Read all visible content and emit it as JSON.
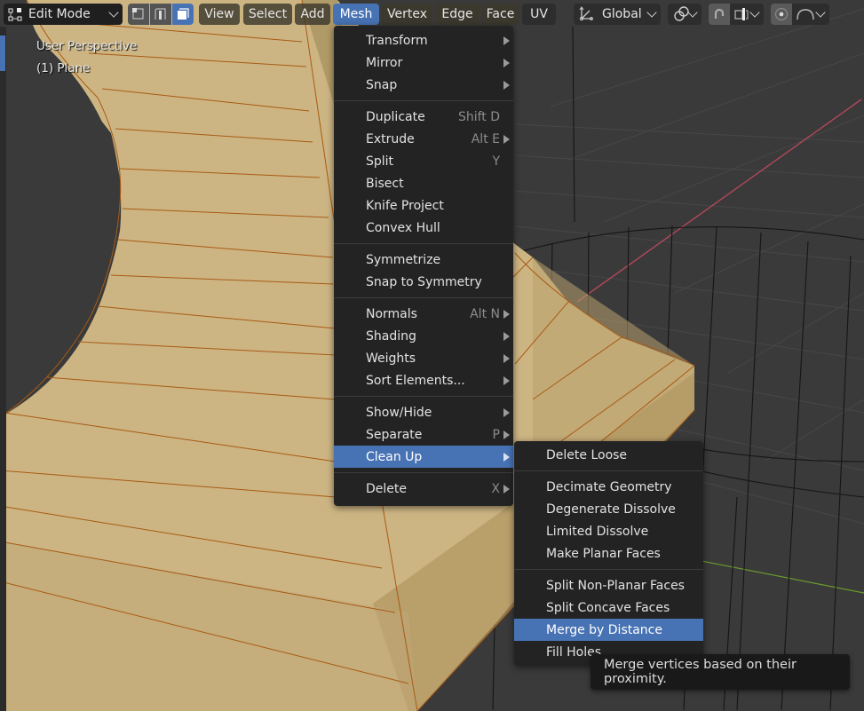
{
  "header": {
    "mode_label": "Edit Mode",
    "menus": [
      "View",
      "Select",
      "Add",
      "Mesh",
      "Vertex",
      "Edge",
      "Face",
      "UV"
    ],
    "active_menu": "Mesh",
    "transform_orientation": "Global",
    "select_modes": [
      "vertex-select-mode",
      "edge-select-mode",
      "face-select-mode"
    ],
    "active_select_mode": "face-select-mode"
  },
  "viewport": {
    "view_name": "User Perspective",
    "object_name": "(1) Plane"
  },
  "mesh_menu": {
    "groups": [
      [
        {
          "label": "Transform",
          "shortcut": "",
          "submenu": true
        },
        {
          "label": "Mirror",
          "shortcut": "",
          "submenu": true
        },
        {
          "label": "Snap",
          "shortcut": "",
          "submenu": true
        }
      ],
      [
        {
          "label": "Duplicate",
          "shortcut": "Shift D",
          "submenu": false
        },
        {
          "label": "Extrude",
          "shortcut": "Alt E",
          "submenu": true
        },
        {
          "label": "Split",
          "shortcut": "Y",
          "submenu": false
        },
        {
          "label": "Bisect",
          "shortcut": "",
          "submenu": false
        },
        {
          "label": "Knife Project",
          "shortcut": "",
          "submenu": false
        },
        {
          "label": "Convex Hull",
          "shortcut": "",
          "submenu": false
        }
      ],
      [
        {
          "label": "Symmetrize",
          "shortcut": "",
          "submenu": false
        },
        {
          "label": "Snap to Symmetry",
          "shortcut": "",
          "submenu": false
        }
      ],
      [
        {
          "label": "Normals",
          "shortcut": "Alt N",
          "submenu": true
        },
        {
          "label": "Shading",
          "shortcut": "",
          "submenu": true
        },
        {
          "label": "Weights",
          "shortcut": "",
          "submenu": true
        },
        {
          "label": "Sort Elements...",
          "shortcut": "",
          "submenu": true
        }
      ],
      [
        {
          "label": "Show/Hide",
          "shortcut": "",
          "submenu": true
        },
        {
          "label": "Separate",
          "shortcut": "P",
          "submenu": true
        },
        {
          "label": "Clean Up",
          "shortcut": "",
          "submenu": true,
          "highlighted": true
        }
      ],
      [
        {
          "label": "Delete",
          "shortcut": "X",
          "submenu": true
        }
      ]
    ]
  },
  "cleanup_menu": {
    "groups": [
      [
        {
          "label": "Delete Loose"
        }
      ],
      [
        {
          "label": "Decimate Geometry"
        },
        {
          "label": "Degenerate Dissolve"
        },
        {
          "label": "Limited Dissolve"
        },
        {
          "label": "Make Planar Faces"
        }
      ],
      [
        {
          "label": "Split Non-Planar Faces"
        },
        {
          "label": "Split Concave Faces"
        },
        {
          "label": "Merge by Distance",
          "highlighted": true
        },
        {
          "label": "Fill Holes"
        }
      ]
    ]
  },
  "tooltip": {
    "text": "Merge vertices based on their proximity."
  },
  "colors": {
    "accent": "#4772b3",
    "menu_bg": "#232323",
    "mesh_face": "#cdb583",
    "mesh_edge": "#a85a14",
    "viewport_bg": "#3a3a3a",
    "x_axis": "#b0485a",
    "y_axis": "#6a9a2a"
  }
}
